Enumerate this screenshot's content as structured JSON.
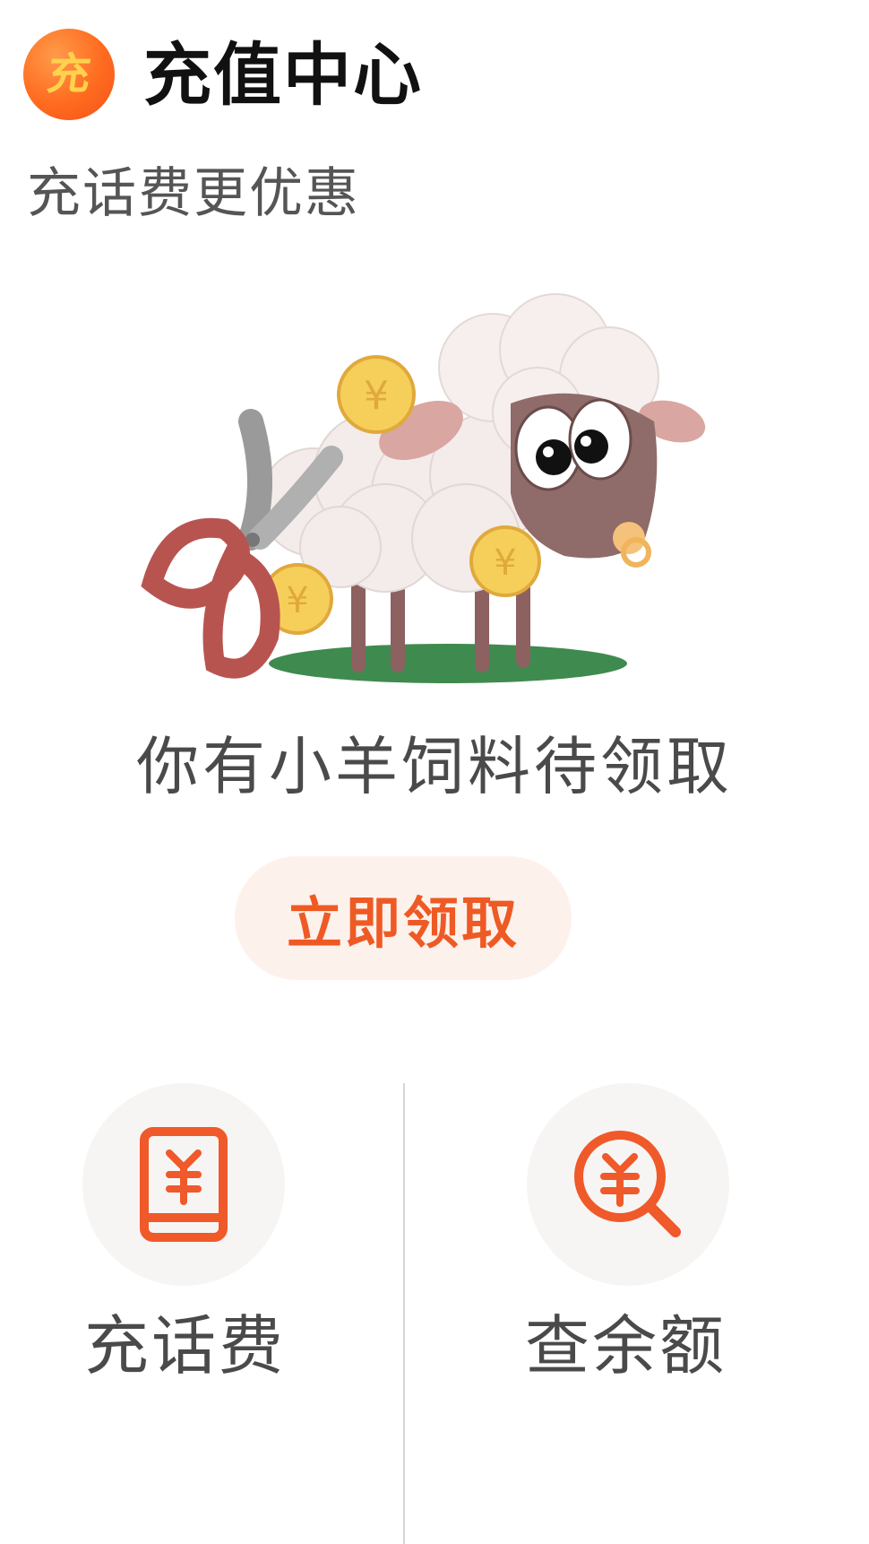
{
  "header": {
    "app_icon_char": "充",
    "title": "充值中心",
    "subtitle": "充话费更优惠"
  },
  "promo": {
    "illustration_icon": "sheep-shearing-illustration",
    "message": "你有小羊饲料待领取",
    "button_label": "立即领取",
    "accent_color": "#ee5a24"
  },
  "actions": [
    {
      "label": "充话费",
      "icon": "phone-yuan-icon"
    },
    {
      "label": "查余额",
      "icon": "search-yuan-icon"
    }
  ],
  "colors": {
    "brand_orange": "#ff6b1f",
    "button_bg": "#fdf1ec",
    "icon_orange": "#f0592a"
  }
}
